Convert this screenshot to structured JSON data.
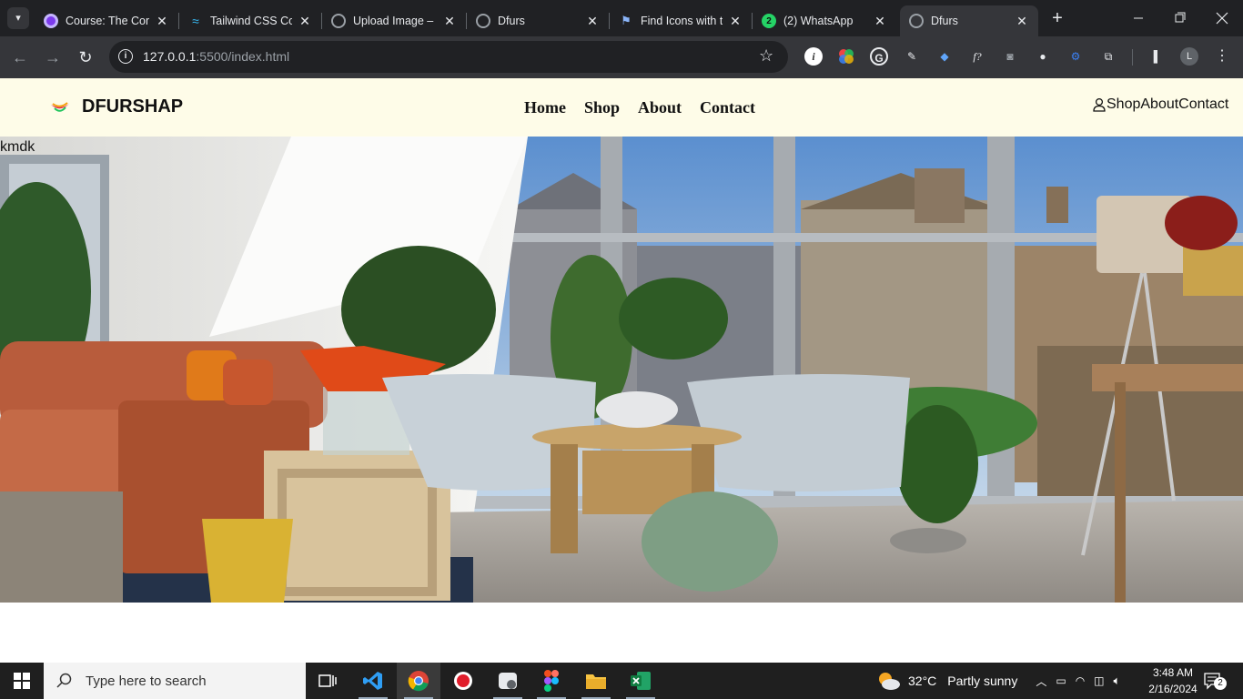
{
  "browser": {
    "tabs": [
      {
        "title": "Course: The Com",
        "favicon": "purple-circle-icon"
      },
      {
        "title": "Tailwind CSS Co",
        "favicon": "tailwind-icon"
      },
      {
        "title": "Upload Image –",
        "favicon": "globe-icon"
      },
      {
        "title": "Dfurs",
        "favicon": "globe-icon"
      },
      {
        "title": "Find Icons with t",
        "favicon": "flag-icon"
      },
      {
        "title": "(2) WhatsApp",
        "favicon": "whatsapp-icon",
        "badge": "2"
      },
      {
        "title": "Dfurs",
        "favicon": "globe-icon",
        "active": true
      }
    ],
    "new_tab": "+",
    "url_host": "127.0.0.1",
    "url_path": ":5500/index.html",
    "window_controls": [
      "minimize",
      "restore",
      "close"
    ]
  },
  "site": {
    "brand": "DFURSHAP",
    "menu": [
      "Home",
      "Shop",
      "About",
      "Contact"
    ],
    "right_nav_text": "ShopAboutContact",
    "stray_text": "kmdk"
  },
  "taskbar": {
    "search_placeholder": "Type here to search",
    "weather_temp": "32°C",
    "weather_desc": "Partly sunny",
    "time": "3:48 AM",
    "date": "2/16/2024",
    "notification_count": "2"
  },
  "colors": {
    "navbar_bg": "#fefce8",
    "tabstrip_bg": "#202124",
    "toolbar_bg": "#35363a"
  }
}
